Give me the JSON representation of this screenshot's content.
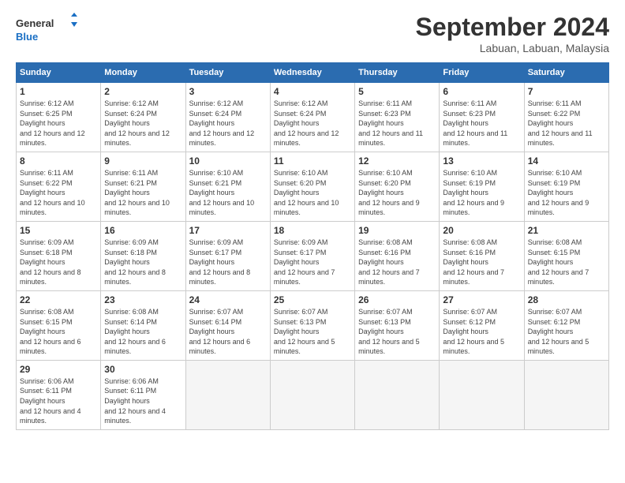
{
  "header": {
    "logo_line1": "General",
    "logo_line2": "Blue",
    "month_title": "September 2024",
    "location": "Labuan, Labuan, Malaysia"
  },
  "weekdays": [
    "Sunday",
    "Monday",
    "Tuesday",
    "Wednesday",
    "Thursday",
    "Friday",
    "Saturday"
  ],
  "weeks": [
    [
      {
        "day": "1",
        "rise": "6:12 AM",
        "set": "6:25 PM",
        "hours": "12 hours and 12 minutes."
      },
      {
        "day": "2",
        "rise": "6:12 AM",
        "set": "6:24 PM",
        "hours": "12 hours and 12 minutes."
      },
      {
        "day": "3",
        "rise": "6:12 AM",
        "set": "6:24 PM",
        "hours": "12 hours and 12 minutes."
      },
      {
        "day": "4",
        "rise": "6:12 AM",
        "set": "6:24 PM",
        "hours": "12 hours and 12 minutes."
      },
      {
        "day": "5",
        "rise": "6:11 AM",
        "set": "6:23 PM",
        "hours": "12 hours and 11 minutes."
      },
      {
        "day": "6",
        "rise": "6:11 AM",
        "set": "6:23 PM",
        "hours": "12 hours and 11 minutes."
      },
      {
        "day": "7",
        "rise": "6:11 AM",
        "set": "6:22 PM",
        "hours": "12 hours and 11 minutes."
      }
    ],
    [
      {
        "day": "8",
        "rise": "6:11 AM",
        "set": "6:22 PM",
        "hours": "12 hours and 10 minutes."
      },
      {
        "day": "9",
        "rise": "6:11 AM",
        "set": "6:21 PM",
        "hours": "12 hours and 10 minutes."
      },
      {
        "day": "10",
        "rise": "6:10 AM",
        "set": "6:21 PM",
        "hours": "12 hours and 10 minutes."
      },
      {
        "day": "11",
        "rise": "6:10 AM",
        "set": "6:20 PM",
        "hours": "12 hours and 10 minutes."
      },
      {
        "day": "12",
        "rise": "6:10 AM",
        "set": "6:20 PM",
        "hours": "12 hours and 9 minutes."
      },
      {
        "day": "13",
        "rise": "6:10 AM",
        "set": "6:19 PM",
        "hours": "12 hours and 9 minutes."
      },
      {
        "day": "14",
        "rise": "6:10 AM",
        "set": "6:19 PM",
        "hours": "12 hours and 9 minutes."
      }
    ],
    [
      {
        "day": "15",
        "rise": "6:09 AM",
        "set": "6:18 PM",
        "hours": "12 hours and 8 minutes."
      },
      {
        "day": "16",
        "rise": "6:09 AM",
        "set": "6:18 PM",
        "hours": "12 hours and 8 minutes."
      },
      {
        "day": "17",
        "rise": "6:09 AM",
        "set": "6:17 PM",
        "hours": "12 hours and 8 minutes."
      },
      {
        "day": "18",
        "rise": "6:09 AM",
        "set": "6:17 PM",
        "hours": "12 hours and 7 minutes."
      },
      {
        "day": "19",
        "rise": "6:08 AM",
        "set": "6:16 PM",
        "hours": "12 hours and 7 minutes."
      },
      {
        "day": "20",
        "rise": "6:08 AM",
        "set": "6:16 PM",
        "hours": "12 hours and 7 minutes."
      },
      {
        "day": "21",
        "rise": "6:08 AM",
        "set": "6:15 PM",
        "hours": "12 hours and 7 minutes."
      }
    ],
    [
      {
        "day": "22",
        "rise": "6:08 AM",
        "set": "6:15 PM",
        "hours": "12 hours and 6 minutes."
      },
      {
        "day": "23",
        "rise": "6:08 AM",
        "set": "6:14 PM",
        "hours": "12 hours and 6 minutes."
      },
      {
        "day": "24",
        "rise": "6:07 AM",
        "set": "6:14 PM",
        "hours": "12 hours and 6 minutes."
      },
      {
        "day": "25",
        "rise": "6:07 AM",
        "set": "6:13 PM",
        "hours": "12 hours and 5 minutes."
      },
      {
        "day": "26",
        "rise": "6:07 AM",
        "set": "6:13 PM",
        "hours": "12 hours and 5 minutes."
      },
      {
        "day": "27",
        "rise": "6:07 AM",
        "set": "6:12 PM",
        "hours": "12 hours and 5 minutes."
      },
      {
        "day": "28",
        "rise": "6:07 AM",
        "set": "6:12 PM",
        "hours": "12 hours and 5 minutes."
      }
    ],
    [
      {
        "day": "29",
        "rise": "6:06 AM",
        "set": "6:11 PM",
        "hours": "12 hours and 4 minutes."
      },
      {
        "day": "30",
        "rise": "6:06 AM",
        "set": "6:11 PM",
        "hours": "12 hours and 4 minutes."
      },
      null,
      null,
      null,
      null,
      null
    ]
  ]
}
